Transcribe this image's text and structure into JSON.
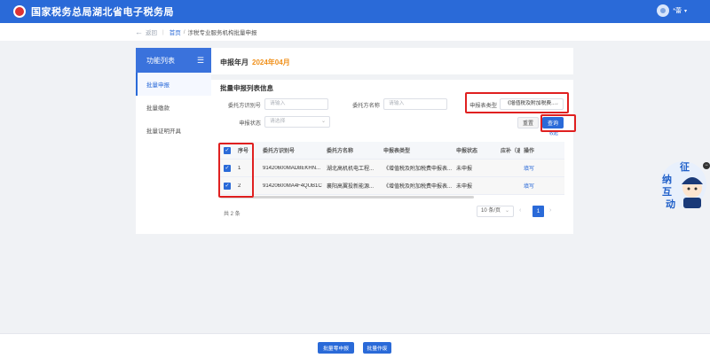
{
  "header": {
    "title": "国家税务总局湖北省电子税务局",
    "user_name": "*蕾",
    "user_caret": "▾",
    "brand_color": "#2a6ad8"
  },
  "breadcrumb": {
    "back_label": "返回",
    "home": "首页",
    "current": "涉税专业服务机构批量申报"
  },
  "sidebar": {
    "title": "功能列表",
    "items": [
      {
        "label": "批量申报",
        "active": true
      },
      {
        "label": "批量缴款",
        "active": false
      },
      {
        "label": "批量证明开具",
        "active": false
      }
    ]
  },
  "main": {
    "period_label": "申报年月",
    "period_value": "2024年04月",
    "section_title": "批量申报列表信息"
  },
  "filters": {
    "client_id_label": "委托方识别号",
    "client_id_placeholder": "请输入",
    "client_name_label": "委托方名称",
    "client_name_placeholder": "请输入",
    "report_type_label": "申报表类型",
    "report_type_value": "《增值税及附加税费...",
    "status_label": "申报状态",
    "status_placeholder": "请选择",
    "reset_label": "重置",
    "query_label": "查询",
    "collapse_label": "收起"
  },
  "table": {
    "headers": [
      "序号",
      "委托方识别号",
      "委托方名称",
      "申报表类型",
      "申报状态",
      "应补（退）",
      "操作"
    ],
    "rows": [
      {
        "no": "1",
        "id": "91420600MAD8EKHN...",
        "name": "湖北高机机电工程...",
        "type": "《增值税及附加税费申报表...",
        "status": "未申报",
        "tax": "",
        "op": "填写"
      },
      {
        "no": "2",
        "id": "91420600MA4F4QUB1C",
        "name": "襄阳高翼投新能源...",
        "type": "《增值税及附加税费申报表...",
        "status": "未申报",
        "tax": "",
        "op": "填写"
      }
    ],
    "total": "共 2 条",
    "page_size": "10 条/页",
    "current_page": "1"
  },
  "mascot": {
    "text": "征纳互动",
    "close_icon": "−"
  },
  "footer": {
    "zero_report_label": "批量零申报",
    "void_label": "批量作废"
  }
}
